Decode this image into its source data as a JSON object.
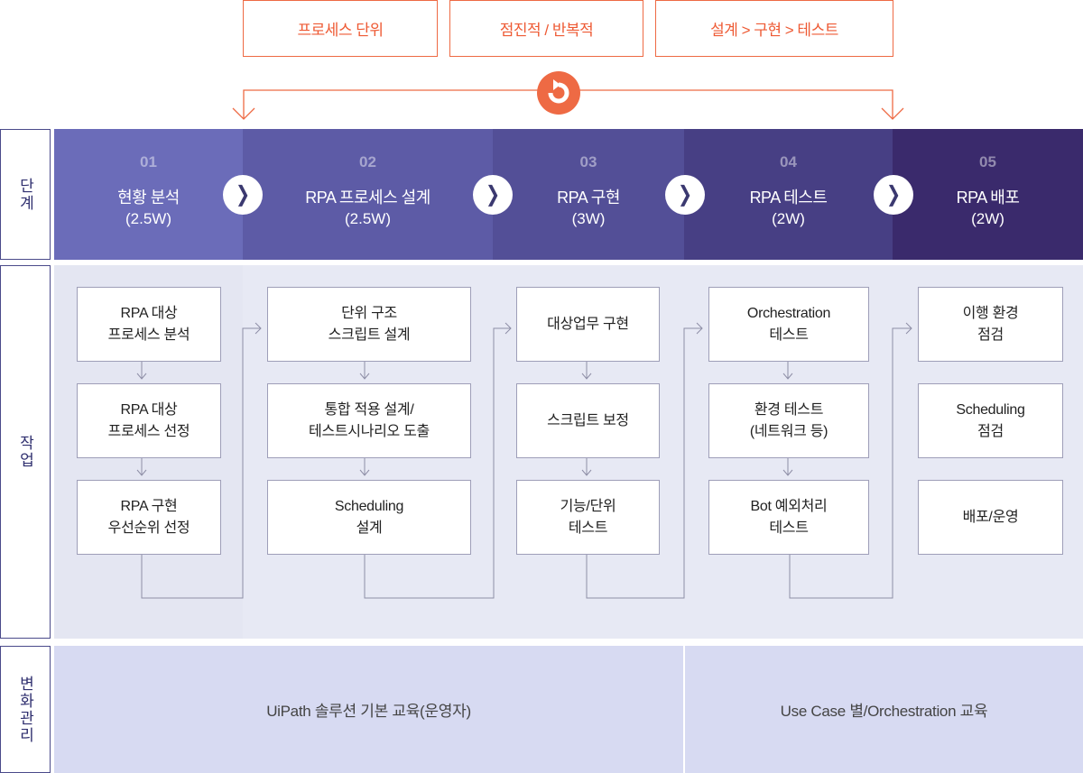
{
  "top_labels": [
    "프로세스 단위",
    "점진적 / 반복적",
    "설계 > 구현 > 테스트"
  ],
  "side_labels": {
    "stage": "단계",
    "work": "작업",
    "change_mgmt": "변화관리"
  },
  "stages": [
    {
      "num": "01",
      "title": "현황 분석",
      "duration": "(2.5W)",
      "color": "#6b6cb9"
    },
    {
      "num": "02",
      "title": "RPA 프로세스 설계",
      "duration": "(2.5W)",
      "color": "#5d5ba6"
    },
    {
      "num": "03",
      "title": "RPA 구현",
      "duration": "(3W)",
      "color": "#534f97"
    },
    {
      "num": "04",
      "title": "RPA 테스트",
      "duration": "(2W)",
      "color": "#473f84"
    },
    {
      "num": "05",
      "title": "RPA 배포",
      "duration": "(2W)",
      "color": "#3a2a6c"
    }
  ],
  "tasks": [
    [
      "RPA 대상\n프로세스 분석",
      "RPA 대상\n프로세스 선정",
      "RPA 구현\n우선순위 선정"
    ],
    [
      "단위 구조\n스크립트 설계",
      "통합 적용 설계/\n테스트시나리오 도출",
      "Scheduling\n설계"
    ],
    [
      "대상업무 구현",
      "스크립트 보정",
      "기능/단위\n테스트"
    ],
    [
      "Orchestration\n테스트",
      "환경 테스트\n(네트워크 등)",
      "Bot 예외처리\n테스트"
    ],
    [
      "이행 환경\n점검",
      "Scheduling\n점검",
      "배포/운영"
    ]
  ],
  "change_management": [
    "UiPath 솔루션 기본 교육(운영자)",
    "Use Case 별/Orchestration 교육"
  ],
  "colors": {
    "accent": "#ee6a44",
    "work_bg": "#e7e9f4",
    "cm_bg": "#d7daf2",
    "connector": "#8e8ea6"
  },
  "icons": [
    "cycle-icon",
    "chevron-right-icon",
    "arrow-down-icon",
    "arrow-right-icon"
  ]
}
